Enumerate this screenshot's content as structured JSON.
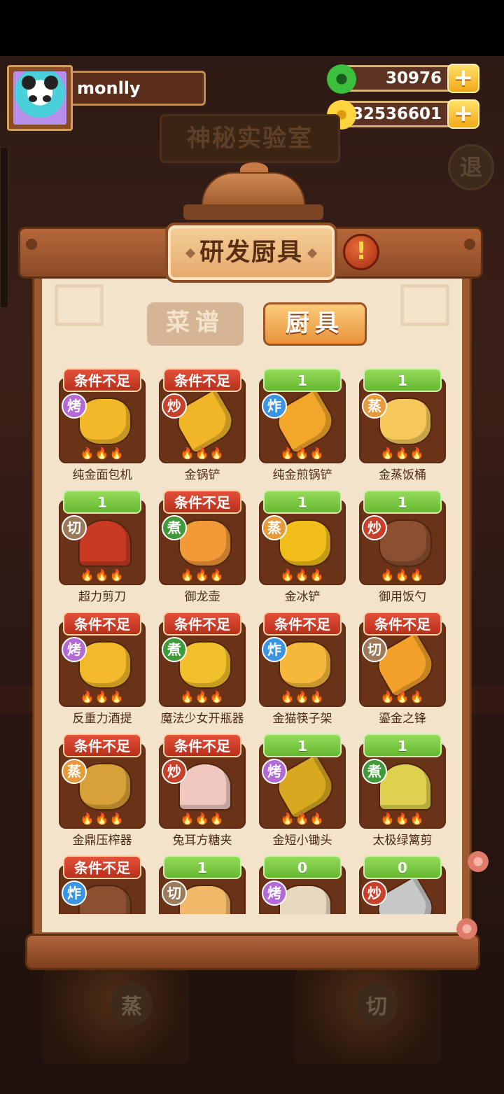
{
  "player": {
    "name": "monlly"
  },
  "currencies": {
    "jade": "30976",
    "gold": "32536601",
    "add_symbol": "+"
  },
  "header": {
    "lab_title": "神秘实验室",
    "exit_label": "退"
  },
  "panel": {
    "title": "研发厨具",
    "alert_symbol": "!"
  },
  "tabs": {
    "recipe": "菜谱",
    "tools": "厨具"
  },
  "flames": "🔥🔥🔥",
  "background": {
    "pot_left": "蒸",
    "pot_right": "切"
  },
  "items": [
    {
      "badge": "条件不足",
      "status": "locked",
      "method": "烤",
      "method_type": "bake",
      "name": "纯金面包机",
      "icon": "toaster-icon",
      "color": "#f2b82a"
    },
    {
      "badge": "条件不足",
      "status": "locked",
      "method": "炒",
      "method_type": "stir",
      "name": "金锅铲",
      "icon": "spatula-icon",
      "color": "#f0b628"
    },
    {
      "badge": "1",
      "status": "owned",
      "method": "炸",
      "method_type": "fry",
      "name": "纯金煎锅铲",
      "icon": "fry-spatula-icon",
      "color": "#f2a62a"
    },
    {
      "badge": "1",
      "status": "owned",
      "method": "蒸",
      "method_type": "steam",
      "name": "金蒸饭桶",
      "icon": "steamer-icon",
      "color": "#f6c85a"
    },
    {
      "badge": "1",
      "status": "owned",
      "method": "切",
      "method_type": "cut",
      "name": "超力剪刀",
      "icon": "scissors-icon",
      "color": "#c83a22"
    },
    {
      "badge": "条件不足",
      "status": "locked",
      "method": "煮",
      "method_type": "boil",
      "name": "御龙壶",
      "icon": "teapot-icon",
      "color": "#f29a38"
    },
    {
      "badge": "1",
      "status": "owned",
      "method": "蒸",
      "method_type": "steam",
      "name": "金冰铲",
      "icon": "ice-scoop-icon",
      "color": "#f2be1a"
    },
    {
      "badge": "1",
      "status": "owned",
      "method": "炒",
      "method_type": "stir",
      "name": "御用饭勺",
      "icon": "ladle-icon",
      "color": "#8a5030"
    },
    {
      "badge": "条件不足",
      "status": "locked",
      "method": "烤",
      "method_type": "bake",
      "name": "反重力酒提",
      "icon": "wine-dipper-icon",
      "color": "#f2ba2a"
    },
    {
      "badge": "条件不足",
      "status": "locked",
      "method": "煮",
      "method_type": "boil",
      "name": "魔法少女开瓶器",
      "icon": "bottle-opener-icon",
      "color": "#f2c02a"
    },
    {
      "badge": "条件不足",
      "status": "locked",
      "method": "炸",
      "method_type": "fry",
      "name": "金猫筷子架",
      "icon": "chopstick-rest-icon",
      "color": "#f6b83a"
    },
    {
      "badge": "条件不足",
      "status": "locked",
      "method": "切",
      "method_type": "cut",
      "name": "鎏金之锋",
      "icon": "blade-icon",
      "color": "#f2a02a"
    },
    {
      "badge": "条件不足",
      "status": "locked",
      "method": "蒸",
      "method_type": "steam",
      "name": "金鼎压榨器",
      "icon": "press-icon",
      "color": "#d8a038"
    },
    {
      "badge": "条件不足",
      "status": "locked",
      "method": "炒",
      "method_type": "stir",
      "name": "兔耳方糖夹",
      "icon": "sugar-tongs-icon",
      "color": "#f0c8c0"
    },
    {
      "badge": "1",
      "status": "owned",
      "method": "烤",
      "method_type": "bake",
      "name": "金短小锄头",
      "icon": "hoe-icon",
      "color": "#d8a820"
    },
    {
      "badge": "1",
      "status": "owned",
      "method": "煮",
      "method_type": "boil",
      "name": "太极绿篱剪",
      "icon": "hedge-shears-icon",
      "color": "#e0d050"
    },
    {
      "badge": "条件不足",
      "status": "locked",
      "method": "炸",
      "method_type": "fry",
      "name": "",
      "icon": "bottle-icon",
      "color": "#8a5030"
    },
    {
      "badge": "1",
      "status": "owned",
      "method": "切",
      "method_type": "cut",
      "name": "",
      "icon": "cat-board-icon",
      "color": "#f2b86a"
    },
    {
      "badge": "0",
      "status": "owned",
      "method": "烤",
      "method_type": "bake",
      "name": "",
      "icon": "toaster-icon",
      "color": "#e8d8c0"
    },
    {
      "badge": "0",
      "status": "owned",
      "method": "炒",
      "method_type": "stir",
      "name": "",
      "icon": "spatula-icon",
      "color": "#c8c8c8"
    }
  ]
}
